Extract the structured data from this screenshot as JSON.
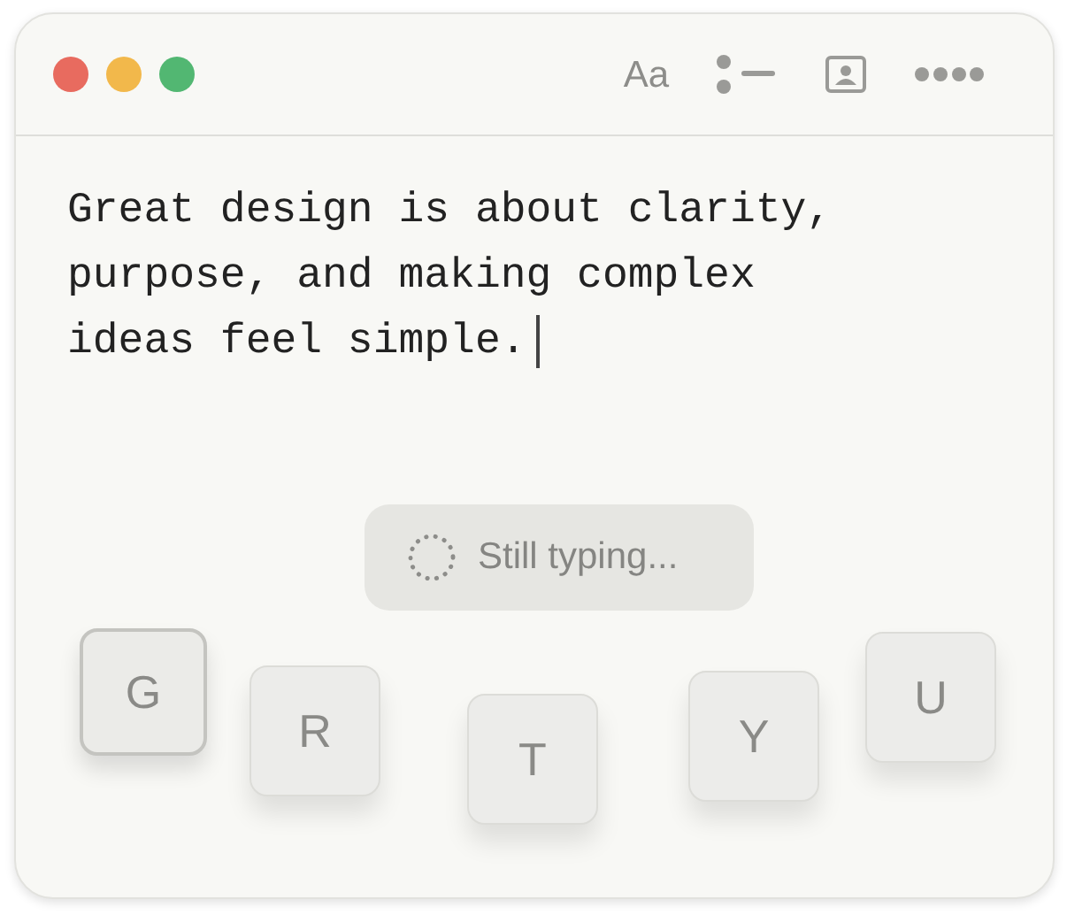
{
  "toolbar": {
    "font_button": "Aa"
  },
  "document": {
    "text": "Great design is about clarity, purpose, and making complex ideas feel simple.",
    "cursor": true
  },
  "status": {
    "label": "Still typing..."
  },
  "keys": [
    {
      "label": "G",
      "pressed": true
    },
    {
      "label": "R",
      "pressed": false
    },
    {
      "label": "T",
      "pressed": false
    },
    {
      "label": "Y",
      "pressed": false
    },
    {
      "label": "U",
      "pressed": false
    }
  ]
}
